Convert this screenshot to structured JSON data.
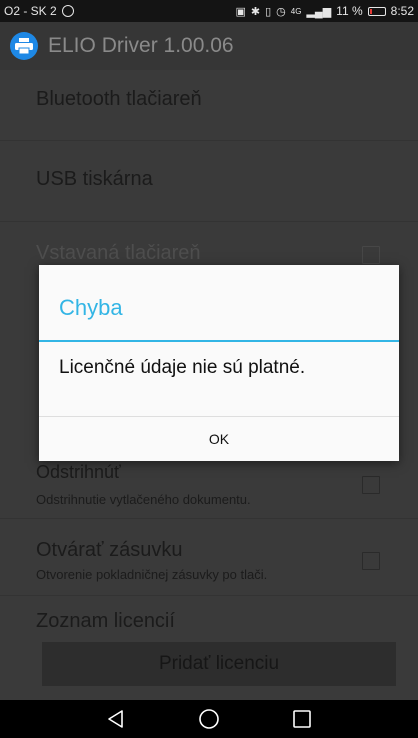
{
  "status_bar": {
    "carrier": "O2 - SK 2",
    "battery_percent": "11 %",
    "time": "8:52",
    "network": "4G"
  },
  "app_bar": {
    "title": "ELIO Driver 1.00.06",
    "logo_icon": "printer-icon",
    "logo_color": "#1e88e5"
  },
  "preferences": {
    "bluetooth_label": "Bluetooth tlačiareň",
    "usb_label": "USB tiskárna",
    "builtin_label": "Vstavaná tlačiareň",
    "builtin_checked": false,
    "cut_label": "Odstrihnúť",
    "cut_summary": "Odstrihnutie vytlačeného dokumentu.",
    "cut_checked": false,
    "drawer_label": "Otvárať zásuvku",
    "drawer_summary": "Otvorenie pokladničnej zásuvky po tlači.",
    "drawer_checked": false,
    "licenses_label": "Zoznam licencií",
    "add_license_button": "Pridať licenciu"
  },
  "dialog": {
    "title": "Chyba",
    "message": "Licenčné údaje nie sú platné.",
    "ok_button": "OK",
    "accent_color": "#33b5e5"
  },
  "nav_bar": {
    "back_icon": "back-triangle-icon",
    "home_icon": "home-circle-icon",
    "recents_icon": "recents-square-icon"
  }
}
